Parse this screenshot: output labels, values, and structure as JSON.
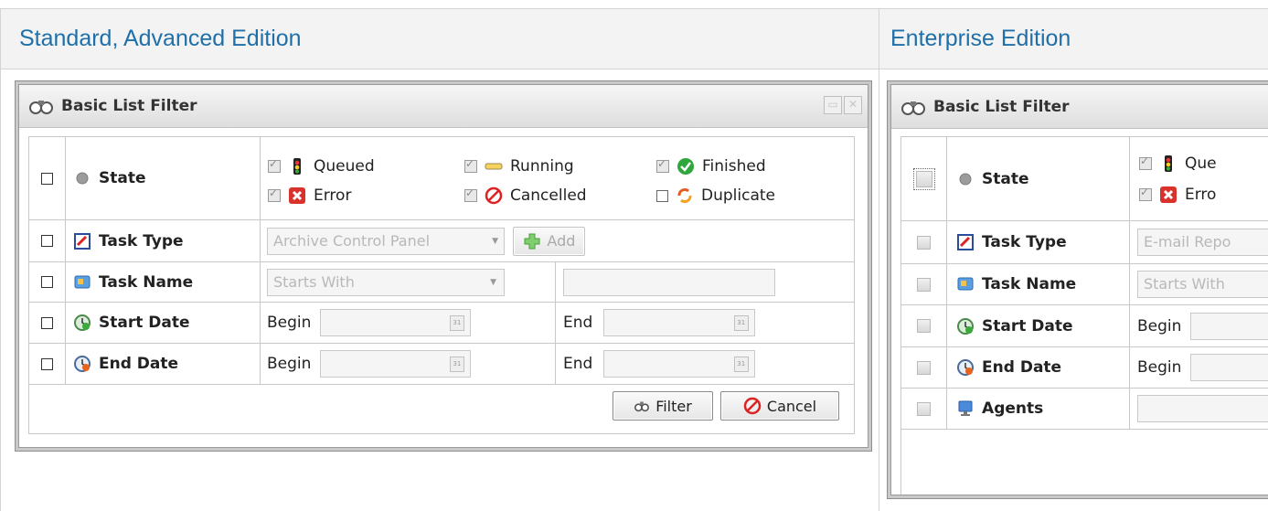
{
  "columns": {
    "left_heading": "Standard, Advanced Edition",
    "right_heading": "Enterprise Edition"
  },
  "colors": {
    "heading": "#1f6fa8",
    "header_bg": "#f3f3f3"
  },
  "left_panel": {
    "title": "Basic List Filter",
    "rows": {
      "state": "State",
      "task_type": "Task Type",
      "task_name": "Task Name",
      "start_date": "Start Date",
      "end_date": "End Date"
    },
    "states": {
      "queued": "Queued",
      "running": "Running",
      "finished": "Finished",
      "error": "Error",
      "cancelled": "Cancelled",
      "duplicate": "Duplicate"
    },
    "task_type_value": "Archive Control Panel",
    "add_label": "Add",
    "task_name_value": "Starts With",
    "begin_label": "Begin",
    "end_label": "End",
    "filter_label": "Filter",
    "cancel_label": "Cancel"
  },
  "right_panel": {
    "title": "Basic List Filter",
    "rows": {
      "state": "State",
      "task_type": "Task Type",
      "task_name": "Task Name",
      "start_date": "Start Date",
      "end_date": "End Date",
      "agents": "Agents"
    },
    "states": {
      "queued": "Que",
      "error": "Erro"
    },
    "task_type_value": "E-mail Repo",
    "task_name_value": "Starts With",
    "begin_label": "Begin"
  }
}
